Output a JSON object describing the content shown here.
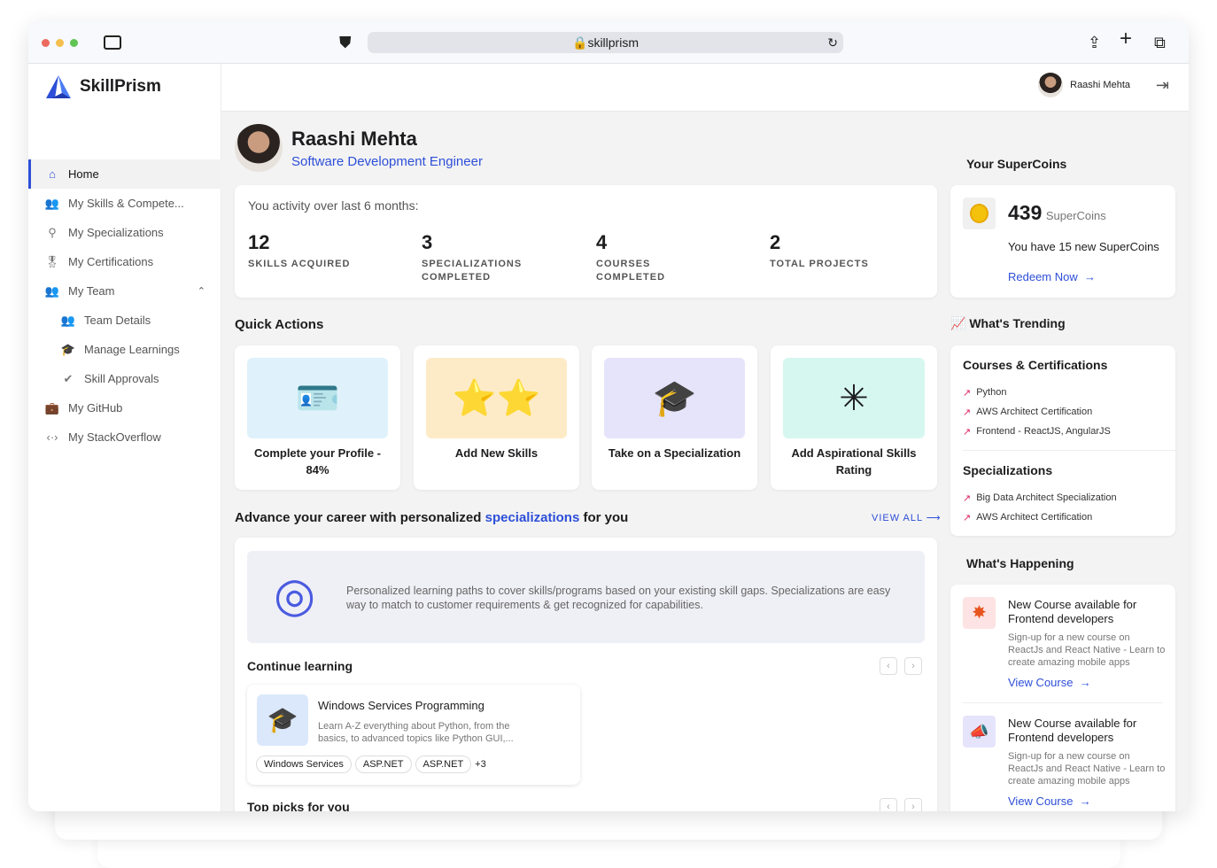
{
  "browser": {
    "url": "skillprism"
  },
  "app": {
    "name": "SkillPrism"
  },
  "user": {
    "name": "Raashi Mehta",
    "role": "Software Development Engineer"
  },
  "sidebar": {
    "items": [
      {
        "label": "Home",
        "icon": "home-icon"
      },
      {
        "label": "My Skills & Compete...",
        "icon": "skills-icon"
      },
      {
        "label": "My Specializations",
        "icon": "specializations-icon"
      },
      {
        "label": "My Certifications",
        "icon": "certifications-icon"
      },
      {
        "label": "My Team",
        "icon": "team-icon"
      },
      {
        "label": "Team Details",
        "icon": "team-details-icon"
      },
      {
        "label": "Manage Learnings",
        "icon": "learnings-icon"
      },
      {
        "label": "Skill Approvals",
        "icon": "approvals-icon"
      },
      {
        "label": "My GitHub",
        "icon": "github-icon"
      },
      {
        "label": "My StackOverflow",
        "icon": "code-icon"
      }
    ]
  },
  "activity": {
    "title": "You activity over last 6 months:",
    "stats": [
      {
        "value": "12",
        "label": "SKILLS ACQUIRED"
      },
      {
        "value": "3",
        "label": "SPECIALIZATIONS COMPLETED"
      },
      {
        "value": "4",
        "label": "COURSES COMPLETED"
      },
      {
        "value": "2",
        "label": "TOTAL PROJECTS"
      }
    ]
  },
  "quick_actions": {
    "title": "Quick Actions",
    "items": [
      {
        "label": "Complete your Profile - 84%",
        "color": "#dff2fb"
      },
      {
        "label": "Add New Skills",
        "color": "#fdebc8"
      },
      {
        "label": "Take on a Specialization",
        "color": "#e6e4fb"
      },
      {
        "label": "Add Aspirational Skills Rating",
        "color": "#d6f7ef"
      }
    ]
  },
  "advance": {
    "prefix": "Advance your career with personalized ",
    "highlight": "specializations",
    "suffix": " for you",
    "view_all": "VIEW ALL",
    "banner": "Personalized learning paths to cover skills/programs based on your existing skill gaps. Specializations are easy way to match to customer requirements & get recognized for capabilities."
  },
  "continue": {
    "title": "Continue learning",
    "course": {
      "title": "Windows Services Programming",
      "desc": "Learn A-Z everything about Python, from the basics, to advanced topics like Python GUI,...",
      "tags": [
        "Windows Services",
        "ASP.NET",
        "ASP.NET"
      ],
      "more": "+3"
    }
  },
  "top_picks": {
    "title": "Top picks for you"
  },
  "supercoins": {
    "title": "Your SuperCoins",
    "count": "439",
    "unit": "SuperCoins",
    "message": "You have 15 new SuperCoins",
    "redeem": "Redeem Now"
  },
  "trending": {
    "title": "What's Trending",
    "courses_title": "Courses & Certifications",
    "courses": [
      "Python",
      "AWS Architect Certification",
      "Frontend - ReactJS, AngularJS"
    ],
    "spec_title": "Specializations",
    "specs": [
      "Big Data Architect Specialization",
      "AWS Architect Certification"
    ]
  },
  "happening": {
    "title": "What's Happening",
    "items": [
      {
        "title": "New Course available for Frontend developers",
        "desc": "Sign-up for a new course on ReactJs and React Native - Learn to create amazing mobile apps",
        "link": "View Course"
      },
      {
        "title": "New Course available for Frontend developers",
        "desc": "Sign-up for a new course on ReactJs and React Native - Learn to create amazing mobile apps",
        "link": "View Course"
      }
    ]
  }
}
